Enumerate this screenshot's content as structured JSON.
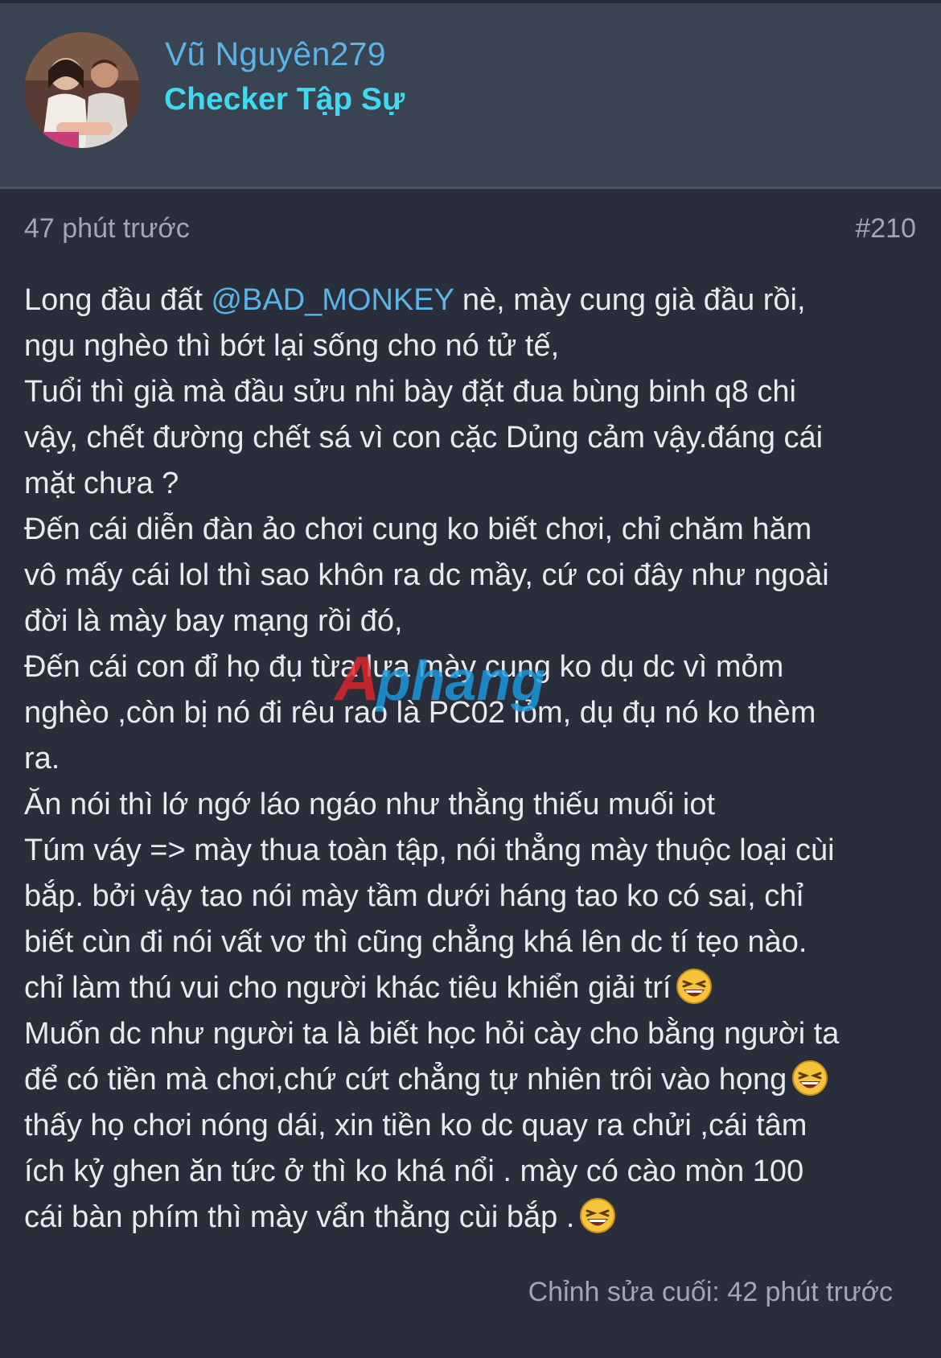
{
  "user": {
    "name": "Vũ Nguyên279",
    "title": "Checker Tập Sự"
  },
  "post": {
    "time": "47 phút trước",
    "number": "#210",
    "lines": {
      "l1a": "Long đầu đất ",
      "mention": "@BAD_MONKEY",
      "l1b": " nè, mày cung già đầu rồi,",
      "l2": "ngu nghèo thì bớt lại sống cho nó tử tế,",
      "l3": "Tuổi thì già mà đầu sửu nhi bày đặt đua bùng binh q8 chi",
      "l4": "vậy, chết đường chết sá vì con cặc Dủng cảm vậy.đáng cái",
      "l5": "mặt chưa ?",
      "l6": "Đến cái diễn đàn ảo chơi cung ko biết chơi, chỉ chăm hăm",
      "l7": "vô mấy cái lol thì sao khôn ra dc mầy, cứ coi đây như ngoài",
      "l8": "đời là mày bay mạng rồi đó,",
      "l9": "Đến cái con đỉ họ đụ từa lưa mày cung ko dụ dc vì mỏm",
      "l10": "nghèo ,còn bị nó đi rêu rao là PC02 lỏm, dụ đụ nó ko thèm",
      "l11": "ra.",
      "l12": "Ăn nói thì lớ ngớ láo ngáo như thằng thiếu muối iot",
      "l13": "Túm váy => mày thua toàn tập, nói thẳng mày thuộc loại cùi",
      "l14": "bắp. bởi vậy tao nói mày tầm dưới háng tao ko có sai, chỉ",
      "l15": "biết cùn đi nói vất vơ thì cũng chẳng khá lên dc tí tẹo nào.",
      "l16": "chỉ làm thú vui cho người khác tiêu khiển giải trí",
      "l17": "Muốn dc như người ta là biết học hỏi cày cho bằng người ta",
      "l18": "để có tiền mà chơi,chứ cứt chẳng tự nhiên trôi vào họng",
      "l19": "thấy họ chơi nóng dái, xin tiền ko dc quay ra chửi ,cái tâm",
      "l20": "ích kỷ ghen ăn tức ở thì ko khá nổi . mày có cào mòn 100",
      "l21": "cái bàn phím thì mày vẩn thằng cùi bắp ."
    },
    "edited": "Chỉnh sửa cuối: 42 phút trước"
  },
  "watermark": {
    "text": "Aphang"
  },
  "icons": {
    "emoji": "laughing-emoji-icon"
  },
  "colors": {
    "background": "#2a2d3a",
    "header": "#3a4351",
    "username": "#5ab4e8",
    "title": "#40d9f0",
    "text": "#e9eaee",
    "muted": "#a3a7b0"
  }
}
